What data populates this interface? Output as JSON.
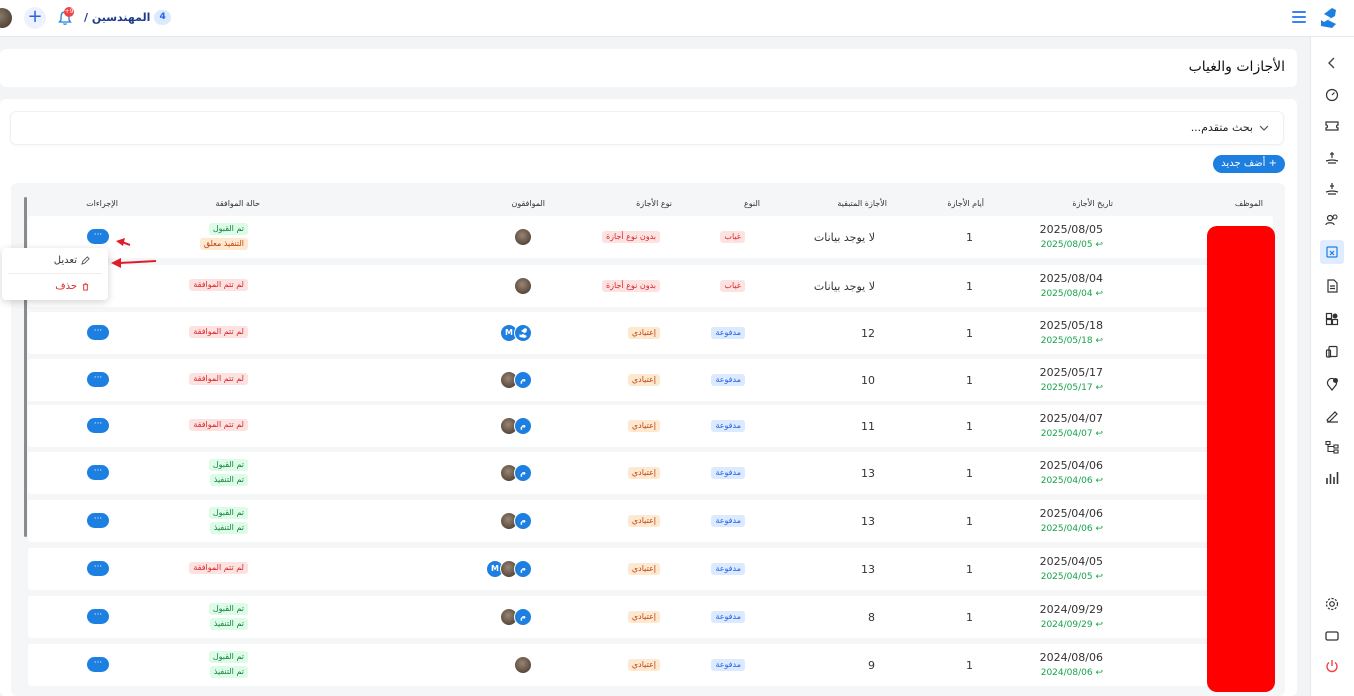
{
  "topbar": {
    "breadcrumb_title": "المهندسين /",
    "breadcrumb_count": "4",
    "notification_count": "+9"
  },
  "page": {
    "title": "الأجازات والغياب"
  },
  "search": {
    "label": "بحث متقدم..."
  },
  "add_button": "+ أضف جديد",
  "columns": {
    "employee": "الموظف",
    "leave_date": "تاريخ الأجازة",
    "leave_days": "أيام الأجازة",
    "remaining": "الأجازة المتبقية",
    "kind": "النوع",
    "leave_type": "نوع الأجازة",
    "approvers": "الموافقون",
    "approval_status": "حالة الموافقة",
    "actions": "الإجراءات"
  },
  "rows": [
    {
      "date": "2025/08/05",
      "date_sub": "2025/08/05 ↩",
      "days": "1",
      "remaining": "لا يوجد بيانات",
      "kind": "غياب",
      "type": "بدون نوع أجازة",
      "status": [
        "تم القبول",
        "التنفيذ معلق"
      ]
    },
    {
      "date": "2025/08/04",
      "date_sub": "2025/08/04 ↩",
      "days": "1",
      "remaining": "لا يوجد بيانات",
      "kind": "غياب",
      "type": "بدون نوع أجازة",
      "status": [
        "لم تتم الموافقة"
      ]
    },
    {
      "date": "2025/05/18",
      "date_sub": "2025/05/18 ↩",
      "days": "1",
      "remaining": "12",
      "kind": "مدفوعة",
      "type": "إعتيادي",
      "status": [
        "لم تتم الموافقة"
      ]
    },
    {
      "date": "2025/05/17",
      "date_sub": "2025/05/17 ↩",
      "days": "1",
      "remaining": "10",
      "kind": "مدفوعة",
      "type": "إعتيادي",
      "status": [
        "لم تتم الموافقة"
      ]
    },
    {
      "date": "2025/04/07",
      "date_sub": "2025/04/07 ↩",
      "days": "1",
      "remaining": "11",
      "kind": "مدفوعة",
      "type": "إعتيادي",
      "status": [
        "لم تتم الموافقة"
      ]
    },
    {
      "date": "2025/04/06",
      "date_sub": "2025/04/06 ↩",
      "days": "1",
      "remaining": "13",
      "kind": "مدفوعة",
      "type": "إعتيادي",
      "status": [
        "تم القبول",
        "تم التنفيذ"
      ]
    },
    {
      "date": "2025/04/06",
      "date_sub": "2025/04/06 ↩",
      "days": "1",
      "remaining": "13",
      "kind": "مدفوعة",
      "type": "إعتيادي",
      "status": [
        "تم القبول",
        "تم التنفيذ"
      ]
    },
    {
      "date": "2025/04/05",
      "date_sub": "2025/04/05 ↩",
      "days": "1",
      "remaining": "13",
      "kind": "مدفوعة",
      "type": "إعتيادي",
      "status": [
        "لم تتم الموافقة"
      ]
    },
    {
      "date": "2024/09/29",
      "date_sub": "2024/09/29 ↩",
      "days": "1",
      "remaining": "8",
      "kind": "مدفوعة",
      "type": "إعتيادي",
      "status": [
        "تم القبول",
        "تم التنفيذ"
      ]
    },
    {
      "date": "2024/08/06",
      "date_sub": "2024/08/06 ↩",
      "days": "1",
      "remaining": "9",
      "kind": "مدفوعة",
      "type": "إعتيادي",
      "status": [
        "تم القبول",
        "تم التنفيذ"
      ]
    }
  ],
  "approver_initials": {
    "m_latin": "M",
    "m_arabic": "م"
  },
  "actions_glyph": "···",
  "dropdown": {
    "edit": "تعديل",
    "delete": "حذف"
  },
  "colors": {
    "accent": "#1d7fe0",
    "danger": "#dc2626",
    "success": "#16a34a",
    "redaction": "#ff0000"
  }
}
